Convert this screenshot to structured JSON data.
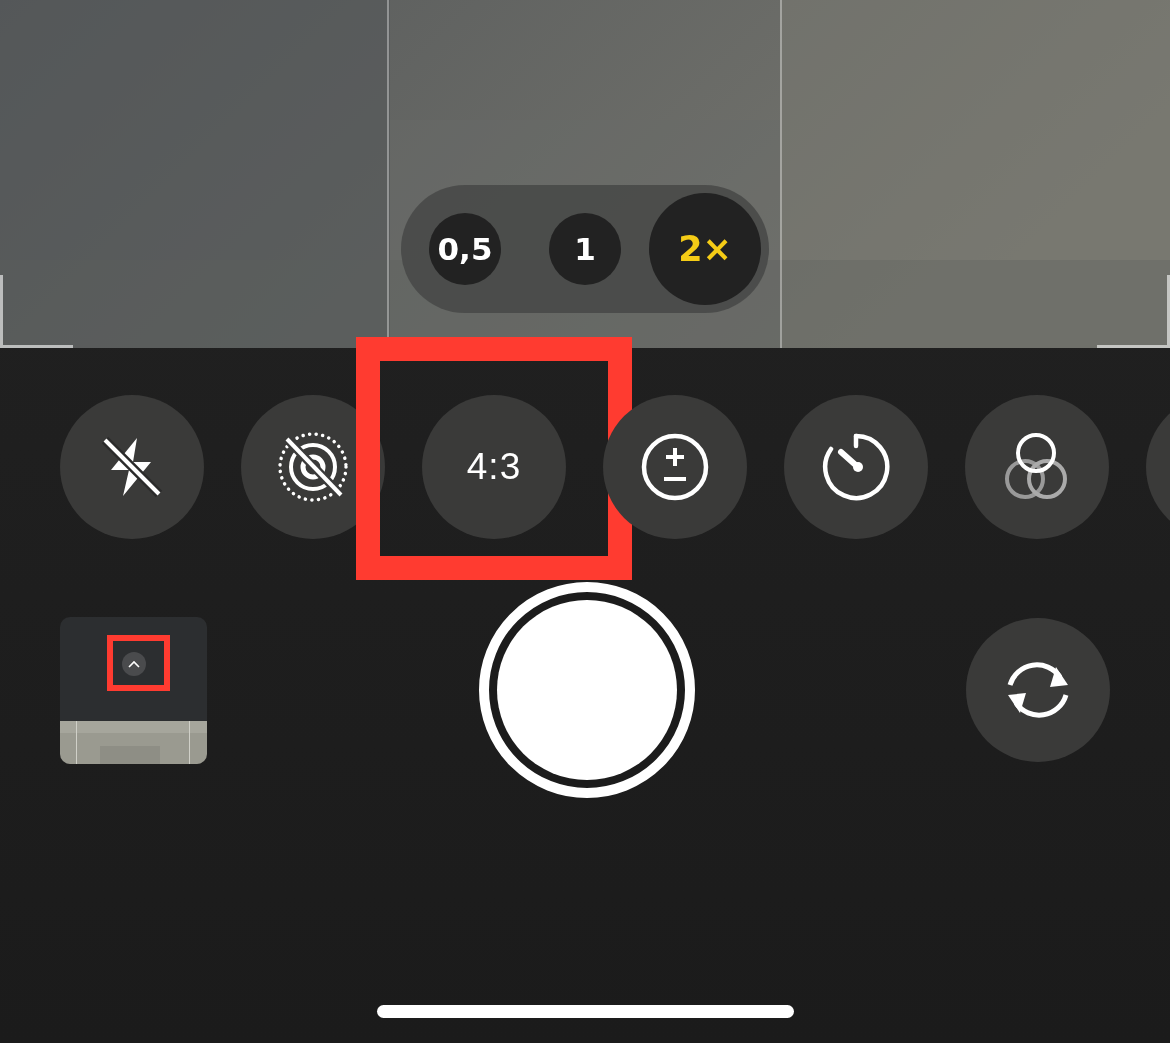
{
  "zoom_levels": [
    {
      "label": "0,5",
      "selected": false
    },
    {
      "label": "1",
      "selected": false
    },
    {
      "label": "2×",
      "selected": true
    }
  ],
  "controls": [
    {
      "kind": "flash",
      "on": false,
      "highlighted": false
    },
    {
      "kind": "live",
      "on": false,
      "highlighted": false
    },
    {
      "kind": "aspect",
      "label": "4:3",
      "highlighted": true
    },
    {
      "kind": "exposure",
      "highlighted": false
    },
    {
      "kind": "timer",
      "highlighted": false
    },
    {
      "kind": "filters",
      "highlighted": false
    },
    {
      "kind": "partial",
      "highlighted": false
    }
  ],
  "thumbnail": {
    "kind": "picture",
    "badge_highlighted": true
  }
}
